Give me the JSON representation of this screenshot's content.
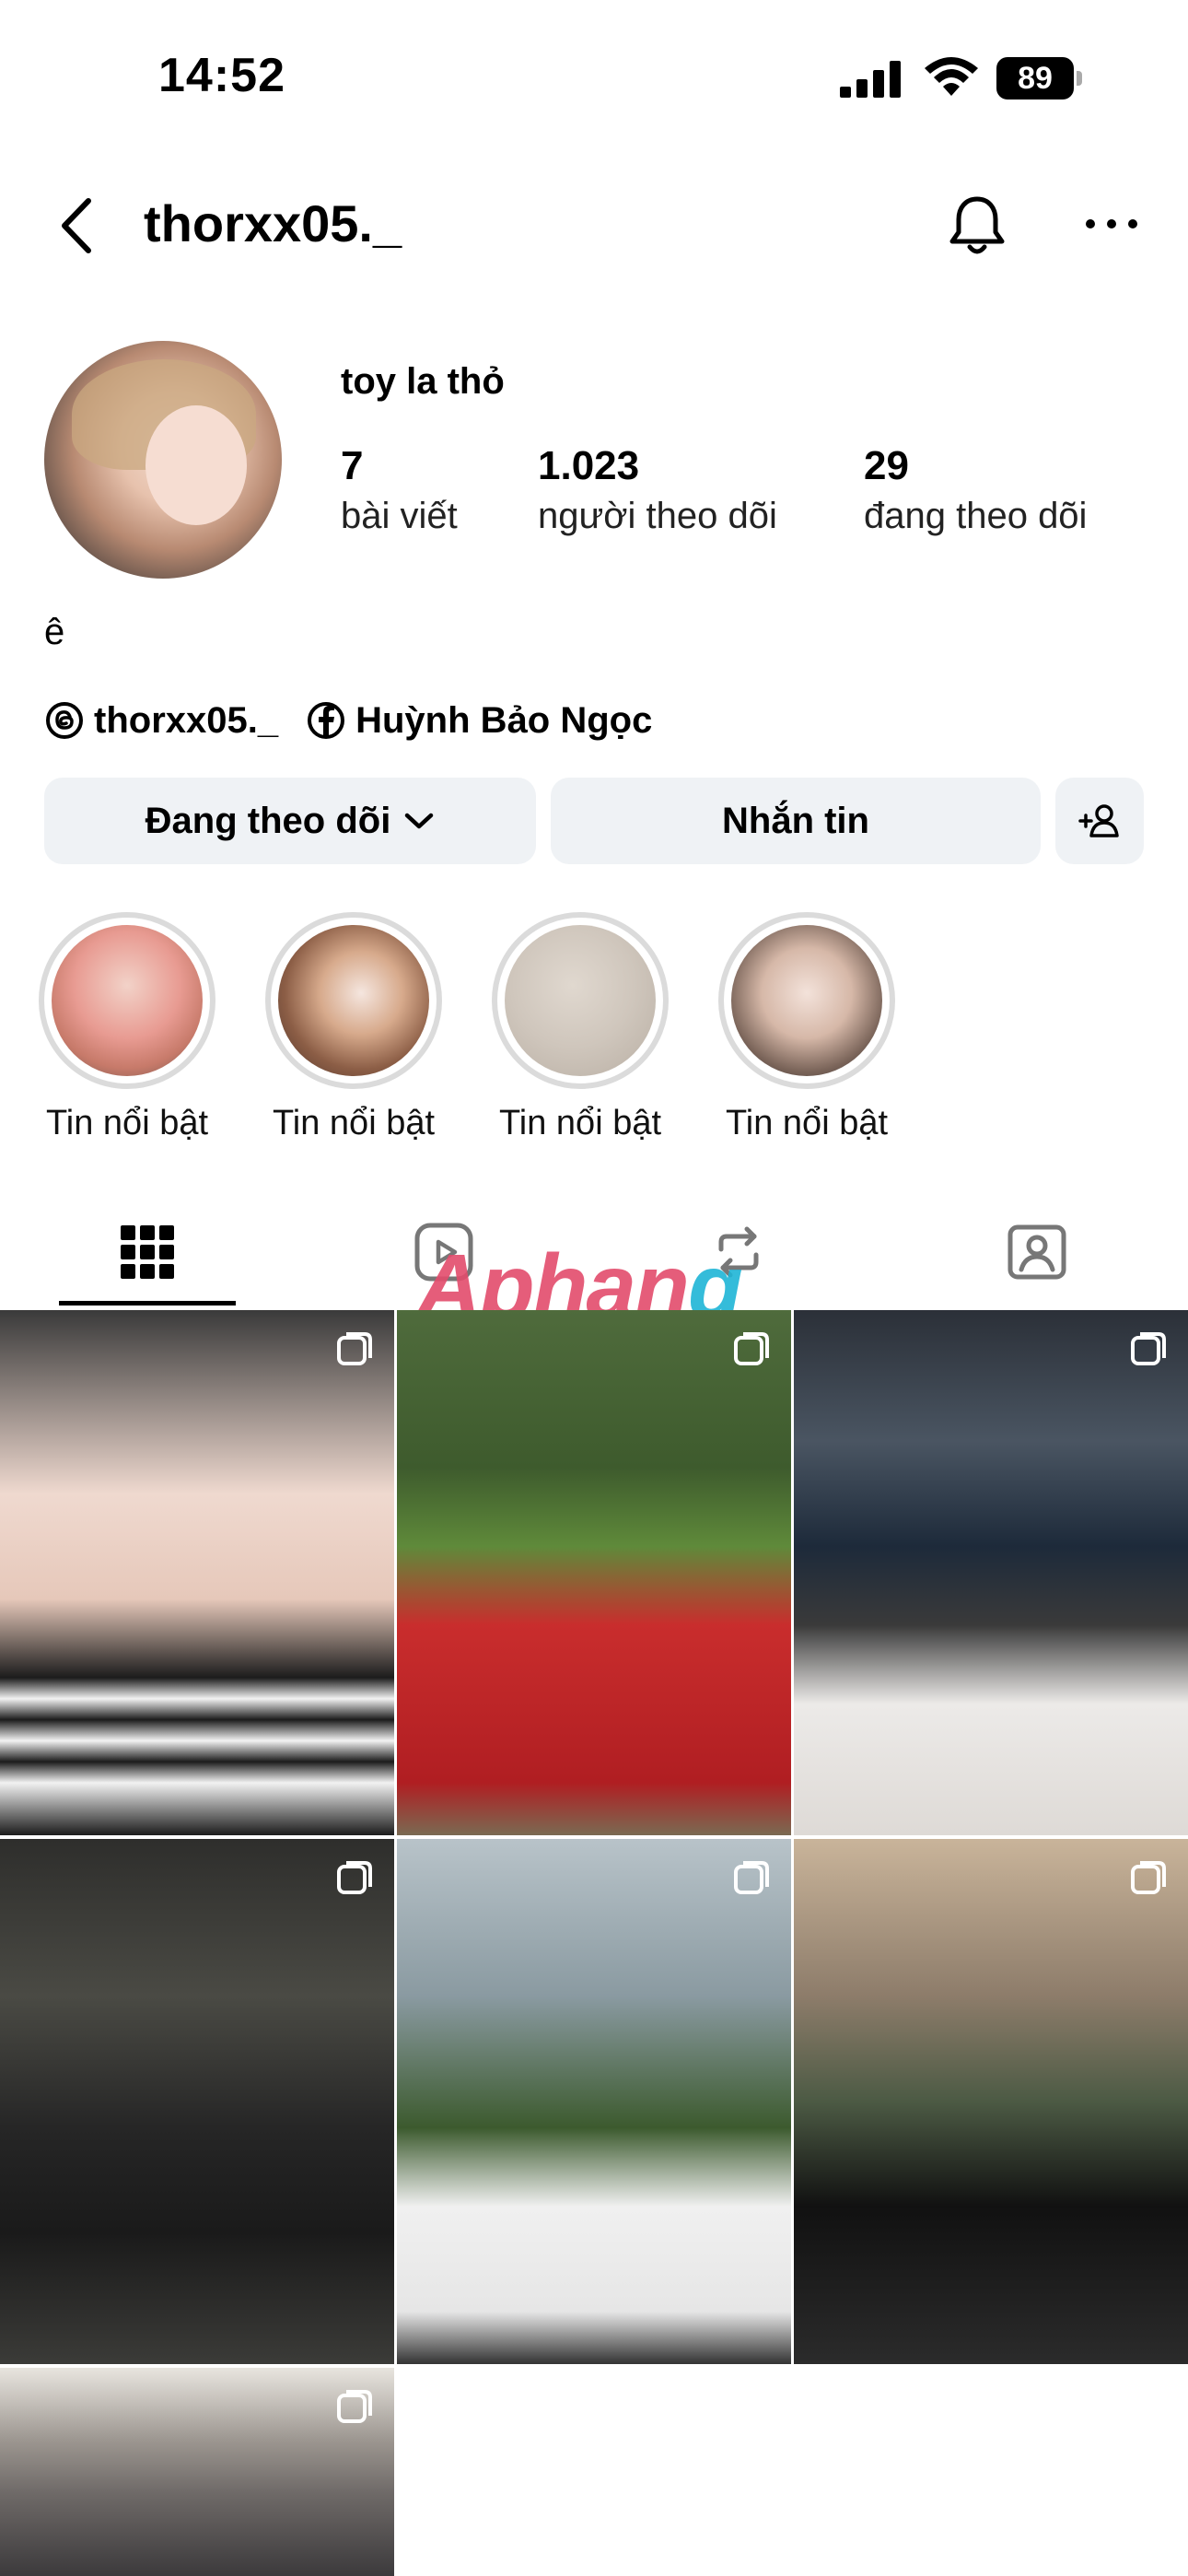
{
  "status": {
    "time": "14:52",
    "battery": "89"
  },
  "header": {
    "username": "thorxx05._"
  },
  "profile": {
    "display_name": "toy la thỏ",
    "stats": [
      {
        "num": "7",
        "label": "bài viết"
      },
      {
        "num": "1.023",
        "label": "người theo dõi"
      },
      {
        "num": "29",
        "label": "đang theo dõi"
      }
    ],
    "bio": "ê",
    "links": {
      "threads": "thorxx05._",
      "facebook": "Huỳnh Bảo Ngọc"
    }
  },
  "buttons": {
    "following": "Đang theo dõi",
    "message": "Nhắn tin"
  },
  "highlights": [
    {
      "label": "Tin nổi bật",
      "color": "#e9a39a"
    },
    {
      "label": "Tin nổi bật",
      "color": "#9c6f58"
    },
    {
      "label": "Tin nổi bật",
      "color": "#cfc6bc"
    },
    {
      "label": "Tin nổi bật",
      "color": "#d8c7bd"
    }
  ],
  "tabs": [
    "posts-grid",
    "reels",
    "reposts",
    "tagged"
  ],
  "watermark": {
    "part1": "Aphan",
    "part2": "g"
  },
  "posts": [
    {
      "bg": "linear-gradient(180deg,#3a3a3a 0%,#efd9cf 35%,#e6c8ba 55%,#1c1c1c 70%,#f2f2f2 74%,#1c1c1c 78%,#f2f2f2 82%,#1c1c1c 86%,#f2f2f2 90%,#1c1c1c 100%)"
    },
    {
      "bg": "linear-gradient(180deg,#4f6b3c 0%,#3e5b2d 30%,#5f8a3a 45%,#c92d2d 60%,#b01e22 90%,#7a6a52 100%)"
    },
    {
      "bg": "linear-gradient(180deg,#2b3038 0%,#4a5562 25%,#1d2a3a 45%,#3a3a3a 60%,#eceae8 75%,#dedad6 100%)"
    },
    {
      "bg": "linear-gradient(180deg,#2e2e2c 0%,#4a4a44 30%,#262626 55%,#1a1a1a 75%,#3b3b38 100%)"
    },
    {
      "bg": "linear-gradient(180deg,#b8c3c9 0%,#8a9aa1 30%,#3c5a2e 55%,#f0f0f0 70%,#e6e6e6 90%,#333 100%)"
    },
    {
      "bg": "linear-gradient(180deg,#c9b49a 0%,#8d7c6a 30%,#4c5a44 50%,#111 70%,#2b2b2b 100%)"
    },
    {
      "bg": "linear-gradient(180deg,#e8e5df 0%,#9c9690 35%,#6f6a68 60%,#3c3a3c 100%)"
    }
  ]
}
